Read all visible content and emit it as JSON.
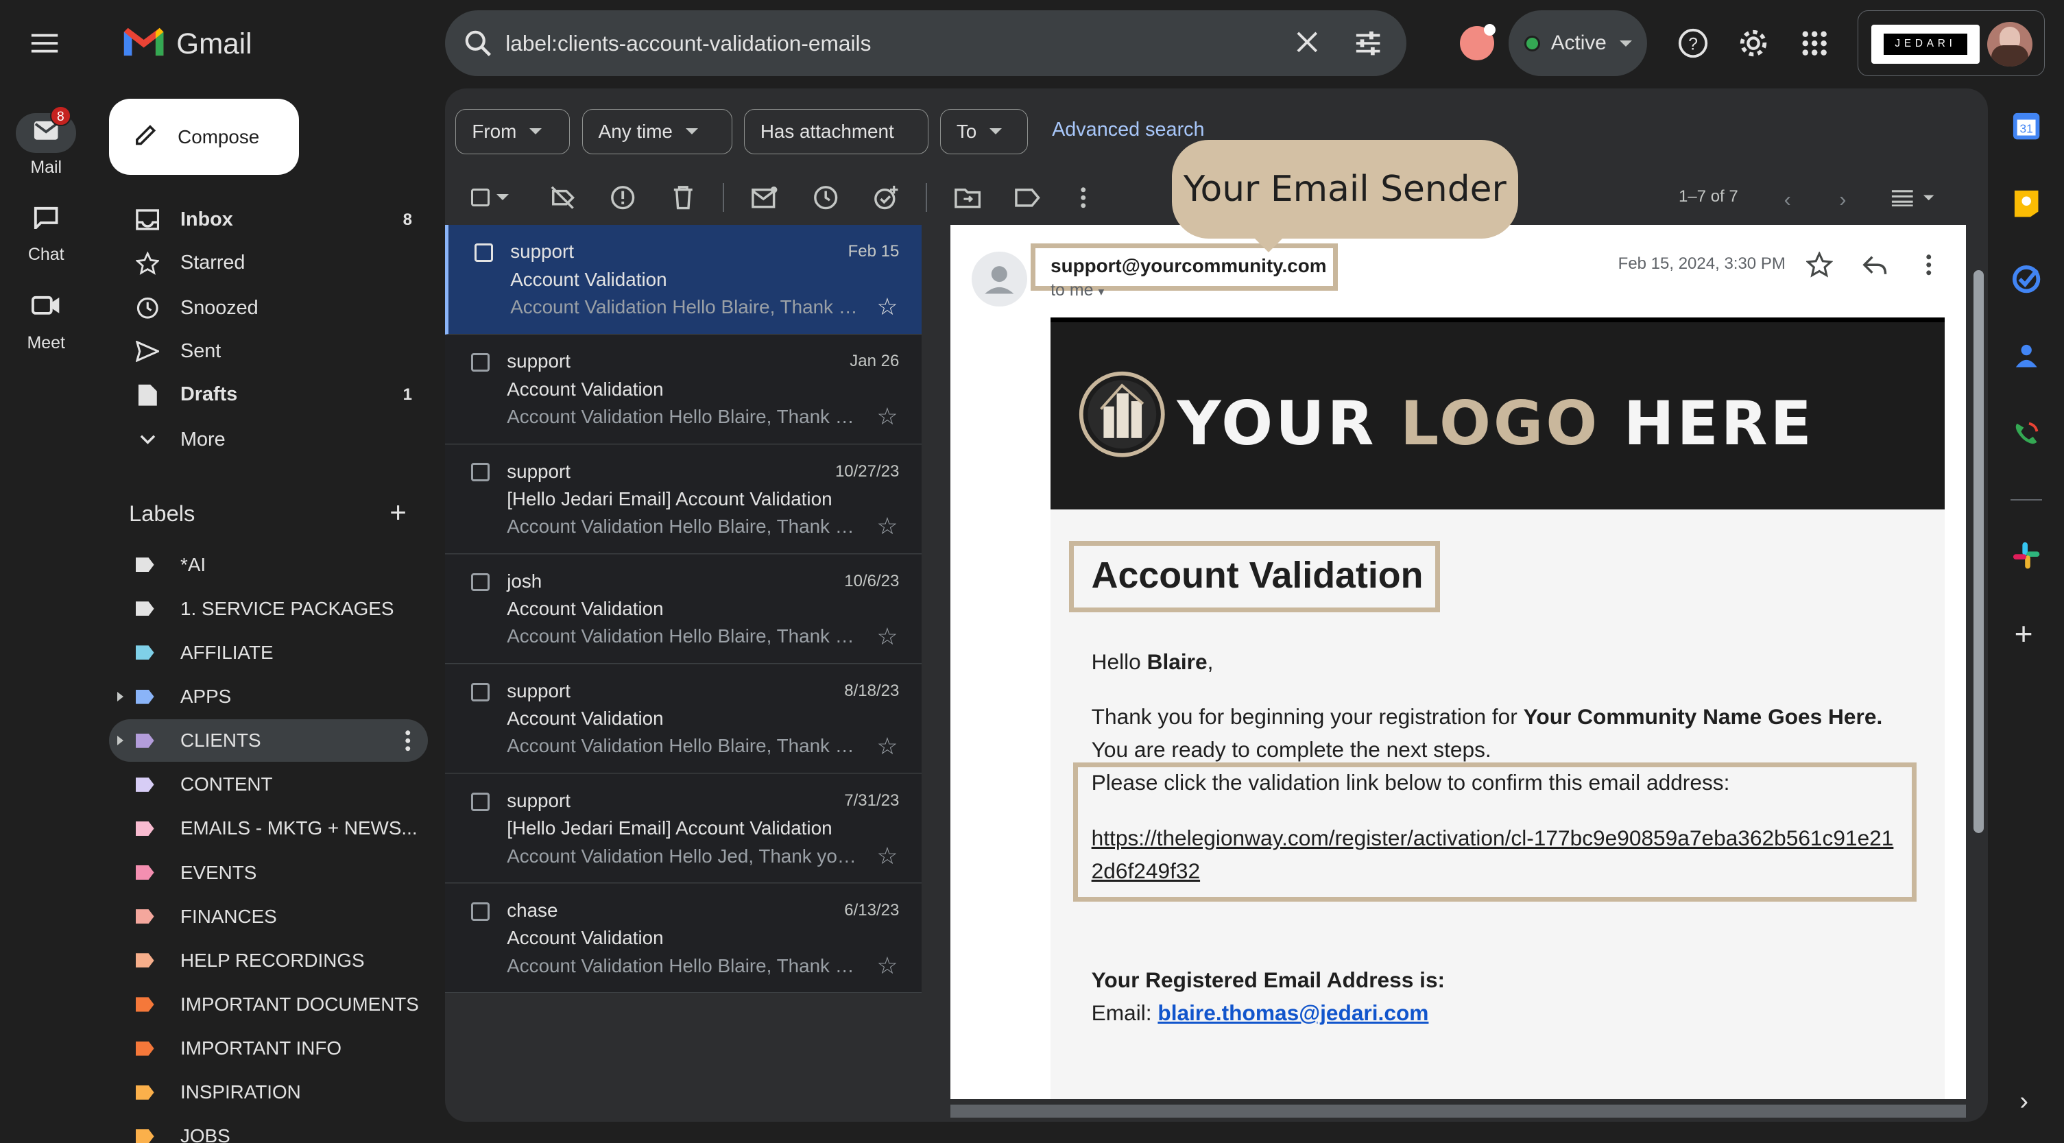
{
  "rail": {
    "mail_label": "Mail",
    "mail_badge": "8",
    "chat_label": "Chat",
    "meet_label": "Meet"
  },
  "header": {
    "brand": "Gmail",
    "search_query": "label:clients-account-validation-emails",
    "status_label": "Active",
    "account_logo_text": "JEDARI"
  },
  "sidebar": {
    "compose_label": "Compose",
    "items": [
      {
        "label": "Inbox",
        "count": "8",
        "icon": "inbox-icon"
      },
      {
        "label": "Starred",
        "count": "",
        "icon": "star-icon"
      },
      {
        "label": "Snoozed",
        "count": "",
        "icon": "clock-icon"
      },
      {
        "label": "Sent",
        "count": "",
        "icon": "send-icon"
      },
      {
        "label": "Drafts",
        "count": "1",
        "icon": "draft-icon"
      },
      {
        "label": "More",
        "count": "",
        "icon": "chevron-down-icon"
      }
    ],
    "labels_heading": "Labels",
    "labels": [
      {
        "label": "*AI",
        "color": "#e3e3e3"
      },
      {
        "label": "1. SERVICE PACKAGES",
        "color": "#e3e3e3"
      },
      {
        "label": "AFFILIATE",
        "color": "#7fd0e8"
      },
      {
        "label": "APPS",
        "color": "#8ab4f8"
      },
      {
        "label": "CLIENTS",
        "color": "#b39ddb"
      },
      {
        "label": "CONTENT",
        "color": "#d7cdf5"
      },
      {
        "label": "EMAILS - MKTG + NEWS...",
        "color": "#f8bbd0"
      },
      {
        "label": "EVENTS",
        "color": "#f48fb1"
      },
      {
        "label": "FINANCES",
        "color": "#f4a79d"
      },
      {
        "label": "HELP RECORDINGS",
        "color": "#f6ae8b"
      },
      {
        "label": "IMPORTANT DOCUMENTS",
        "color": "#f5783a"
      },
      {
        "label": "IMPORTANT INFO",
        "color": "#f5783a"
      },
      {
        "label": "INSPIRATION",
        "color": "#fbb04b"
      },
      {
        "label": "JOBS",
        "color": "#fbb04b"
      }
    ]
  },
  "filters": {
    "from": "From",
    "any_time": "Any time",
    "has_attachment": "Has attachment",
    "to": "To",
    "advanced": "Advanced search"
  },
  "toolbar": {
    "pagination": "1–7 of 7"
  },
  "emails": [
    {
      "from": "support",
      "date": "Feb 15",
      "subject": "Account Validation",
      "snippet": "Account Validation Hello Blaire, Thank you for beginning"
    },
    {
      "from": "support",
      "date": "Jan 26",
      "subject": "Account Validation",
      "snippet": "Account Validation Hello Blaire, Thank you for beginning"
    },
    {
      "from": "support",
      "date": "10/27/23",
      "subject": "[Hello Jedari Email] Account Validation",
      "snippet": "Account Validation Hello Blaire, Thank you for beginning"
    },
    {
      "from": "josh",
      "date": "10/6/23",
      "subject": "Account Validation",
      "snippet": "Account Validation Hello Blaire, Thank you for beginning"
    },
    {
      "from": "support",
      "date": "8/18/23",
      "subject": "Account Validation",
      "snippet": "Account Validation Hello Blaire, Thank you for beginning"
    },
    {
      "from": "support",
      "date": "7/31/23",
      "subject": "[Hello Jedari Email] Account Validation",
      "snippet": "Account Validation Hello Jed, Thank you for beginning"
    },
    {
      "from": "chase",
      "date": "6/13/23",
      "subject": "Account Validation",
      "snippet": "Account Validation Hello Blaire, Thank you for beginning"
    }
  ],
  "message": {
    "sender": "support@yourcommunity.com",
    "to_me": "to me",
    "timestamp": "Feb 15, 2024, 3:30 PM",
    "callout": "Your Email Sender",
    "logo_your": "YOUR",
    "logo_logo": "LOGO",
    "logo_here": "HERE",
    "title": "Account Validation",
    "hello": "Hello ",
    "name": "Blaire",
    "comma": ",",
    "thanks_pre": "Thank you for beginning your registration for ",
    "community": "Your Community Name Goes Here.",
    "ready": "You are ready to complete the next steps.",
    "click_text": "Please click the validation link below to confirm this email address:",
    "link_line1": "https://thelegionway.com/register/activation/cl-177bc9e90859a7eba362b561c91e21",
    "link_line2": "2d6f249f32",
    "registered_heading": "Your Registered Email Address is:",
    "email_label": "Email: ",
    "email_value": "blaire.thomas@jedari.com"
  }
}
